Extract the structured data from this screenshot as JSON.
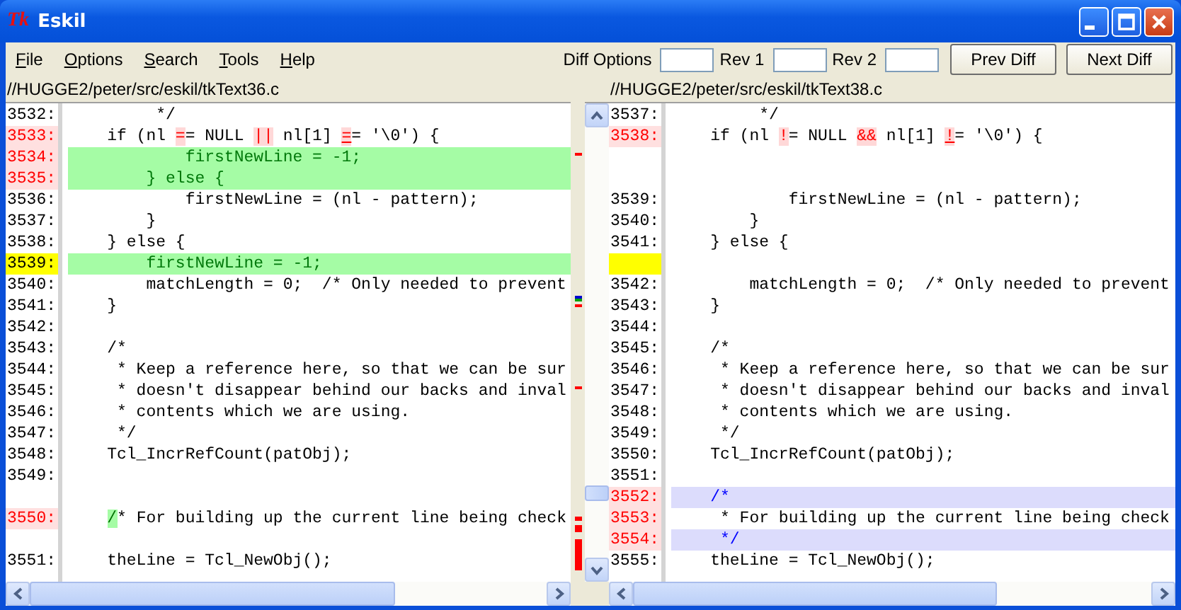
{
  "window": {
    "icon_text": "Tk",
    "title": "Eskil"
  },
  "menu": [
    "File",
    "Options",
    "Search",
    "Tools",
    "Help"
  ],
  "toolbar": {
    "diff_options_label": "Diff Options",
    "rev1_label": "Rev 1",
    "rev2_label": "Rev 2",
    "buttons": [
      "Prev Diff",
      "Next Diff"
    ]
  },
  "left": {
    "path": "//HUGGE2/peter/src/eskil/tkText36.c",
    "lines": [
      {
        "num": "3532:",
        "text": "         */",
        "changed": false,
        "current": false,
        "kind": "plain"
      },
      {
        "num": "3533:",
        "segments": [
          {
            "text": "    if (nl ",
            "kind": "plain"
          },
          {
            "text": "=",
            "kind": "change"
          },
          {
            "text": "= NULL ",
            "kind": "plain"
          },
          {
            "text": "||",
            "kind": "change"
          },
          {
            "text": " nl[1] ",
            "kind": "plain"
          },
          {
            "text": "=",
            "kind": "cursor"
          },
          {
            "text": "= '\\0') {",
            "kind": "plain"
          }
        ],
        "changed": true,
        "current": false,
        "kind": "plain"
      },
      {
        "num": "3534:",
        "text": "            firstNewLine = -1;",
        "changed": true,
        "current": false,
        "kind": "added"
      },
      {
        "num": "3535:",
        "text": "        } else {",
        "changed": true,
        "current": false,
        "kind": "added"
      },
      {
        "num": "3536:",
        "text": "            firstNewLine = (nl - pattern);",
        "changed": false,
        "current": false,
        "kind": "plain"
      },
      {
        "num": "3537:",
        "text": "        }",
        "changed": false,
        "current": false,
        "kind": "plain"
      },
      {
        "num": "3538:",
        "text": "    } else {",
        "changed": false,
        "current": false,
        "kind": "plain"
      },
      {
        "num": "3539:",
        "text": "        firstNewLine = -1;",
        "changed": false,
        "current": true,
        "kind": "added"
      },
      {
        "num": "3540:",
        "text": "        matchLength = 0;  /* Only needed to prevent",
        "changed": false,
        "current": false,
        "kind": "plain"
      },
      {
        "num": "3541:",
        "text": "    }",
        "changed": false,
        "current": false,
        "kind": "plain"
      },
      {
        "num": "3542:",
        "changed": false,
        "current": false
      },
      {
        "num": "3543:",
        "text": "    /*",
        "changed": false,
        "current": false,
        "kind": "plain"
      },
      {
        "num": "3544:",
        "text": "     * Keep a reference here, so that we can be sur",
        "changed": false,
        "current": false,
        "kind": "plain"
      },
      {
        "num": "3545:",
        "text": "     * doesn't disappear behind our backs and inval",
        "changed": false,
        "current": false,
        "kind": "plain"
      },
      {
        "num": "3546:",
        "text": "     * contents which we are using.",
        "changed": false,
        "current": false,
        "kind": "plain"
      },
      {
        "num": "3547:",
        "text": "     */",
        "changed": false,
        "current": false,
        "kind": "plain"
      },
      {
        "num": "3548:",
        "text": "    Tcl_IncrRefCount(patObj);",
        "changed": false,
        "current": false,
        "kind": "plain"
      },
      {
        "num": "3549:",
        "changed": false,
        "current": false
      },
      {
        "changed": false,
        "current": false
      },
      {
        "num": "3550:",
        "segments": [
          {
            "text": "    /",
            "kind": "add-tail"
          },
          {
            "text": "* For building up the current line being check",
            "kind": "plain"
          }
        ],
        "changed": true,
        "current": false,
        "kind": "plain"
      },
      {
        "changed": false,
        "current": false
      },
      {
        "num": "3551:",
        "text": "    theLine = Tcl_NewObj();",
        "changed": false,
        "current": false,
        "kind": "plain"
      }
    ]
  },
  "right": {
    "path": "//HUGGE2/peter/src/eskil/tkText38.c",
    "lines": [
      {
        "num": "3537:",
        "text": "         */",
        "changed": false,
        "current": false,
        "kind": "plain"
      },
      {
        "num": "3538:",
        "segments": [
          {
            "text": "    if (nl ",
            "kind": "plain"
          },
          {
            "text": "!",
            "kind": "change"
          },
          {
            "text": "= NULL ",
            "kind": "plain"
          },
          {
            "text": "&&",
            "kind": "change"
          },
          {
            "text": " nl[1] ",
            "kind": "plain"
          },
          {
            "text": "!",
            "kind": "cursor"
          },
          {
            "text": "= '\\0') {",
            "kind": "plain"
          }
        ],
        "changed": true,
        "current": false,
        "kind": "plain"
      },
      {
        "changed": false,
        "current": false
      },
      {
        "changed": false,
        "current": false
      },
      {
        "num": "3539:",
        "text": "            firstNewLine = (nl - pattern);",
        "changed": false,
        "current": false,
        "kind": "plain"
      },
      {
        "num": "3540:",
        "text": "        }",
        "changed": false,
        "current": false,
        "kind": "plain"
      },
      {
        "num": "3541:",
        "text": "    } else {",
        "changed": false,
        "current": false,
        "kind": "plain"
      },
      {
        "changed": false,
        "current": true
      },
      {
        "num": "3542:",
        "text": "        matchLength = 0;  /* Only needed to prevent",
        "changed": false,
        "current": false,
        "kind": "plain"
      },
      {
        "num": "3543:",
        "text": "    }",
        "changed": false,
        "current": false,
        "kind": "plain"
      },
      {
        "num": "3544:",
        "changed": false,
        "current": false
      },
      {
        "num": "3545:",
        "text": "    /*",
        "changed": false,
        "current": false,
        "kind": "plain"
      },
      {
        "num": "3546:",
        "text": "     * Keep a reference here, so that we can be sur",
        "changed": false,
        "current": false,
        "kind": "plain"
      },
      {
        "num": "3547:",
        "text": "     * doesn't disappear behind our backs and inval",
        "changed": false,
        "current": false,
        "kind": "plain"
      },
      {
        "num": "3548:",
        "text": "     * contents which we are using.",
        "changed": false,
        "current": false,
        "kind": "plain"
      },
      {
        "num": "3549:",
        "text": "     */",
        "changed": false,
        "current": false,
        "kind": "plain"
      },
      {
        "num": "3550:",
        "text": "    Tcl_IncrRefCount(patObj);",
        "changed": false,
        "current": false,
        "kind": "plain"
      },
      {
        "num": "3551:",
        "changed": false,
        "current": false
      },
      {
        "num": "3552:",
        "text": "    /*",
        "changed": true,
        "current": false,
        "kind": "inserted"
      },
      {
        "num": "3553:",
        "text": "     * For building up the current line being check",
        "changed": true,
        "current": false,
        "kind": "plain"
      },
      {
        "num": "3554:",
        "text": "     */",
        "changed": true,
        "current": false,
        "kind": "inserted"
      },
      {
        "num": "3555:",
        "text": "    theLine = Tcl_NewObj();",
        "changed": false,
        "current": false,
        "kind": "plain"
      }
    ]
  }
}
